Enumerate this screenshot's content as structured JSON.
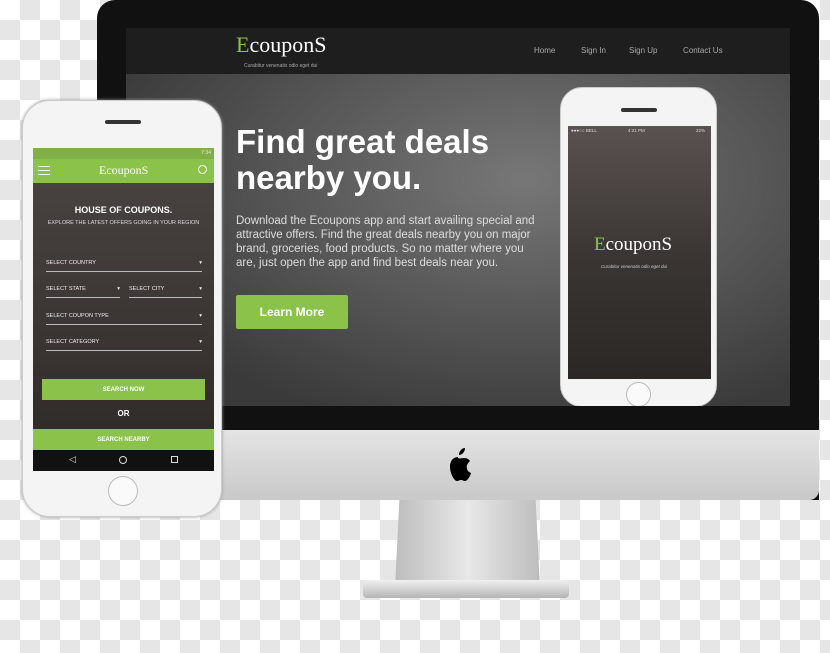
{
  "colors": {
    "accent": "#8bc34a",
    "nav_bg": "#1e1e1e"
  },
  "desktop": {
    "logo": {
      "first": "E",
      "rest": "couponS",
      "tagline": "Curabitur venenatis odio eget dui"
    },
    "nav": [
      "Home",
      "Sign In",
      "Sign Up",
      "Contact Us"
    ],
    "hero_title_1": "Find great deals",
    "hero_title_2": "nearby you.",
    "description": "Download the Ecoupons app and start availing special and attractive offers. Find the great deals nearby you on major brand, groceries, food products. So no matter where you are, just open the app and find best deals near you.",
    "learn_more": "Learn More"
  },
  "iphone": {
    "status_left": "●●●○○ BELL",
    "status_time": "4:21 PM",
    "status_right": "22%",
    "logo": {
      "first": "E",
      "rest": "couponS",
      "tagline": "Curabitur venenatis odio eget dui"
    }
  },
  "android": {
    "status_time": "7:34",
    "logo": "EcouponS",
    "heading": "HOUSE OF COUPONS.",
    "subheading": "EXPLORE THE LATEST OFFERS GOING IN YOUR REGION",
    "selects": {
      "country": "SELECT COUNTRY",
      "state": "SELECT STATE",
      "city": "SELECT CITY",
      "coupon_type": "SELECT COUPON TYPE",
      "category": "SELECT CATEGORY"
    },
    "search_now": "SEARCH NOW",
    "or": "OR",
    "search_nearby": "SEARCH NEARBY",
    "icons": [
      "menu-icon",
      "search-icon",
      "back-icon",
      "home-icon",
      "recents-icon"
    ]
  }
}
